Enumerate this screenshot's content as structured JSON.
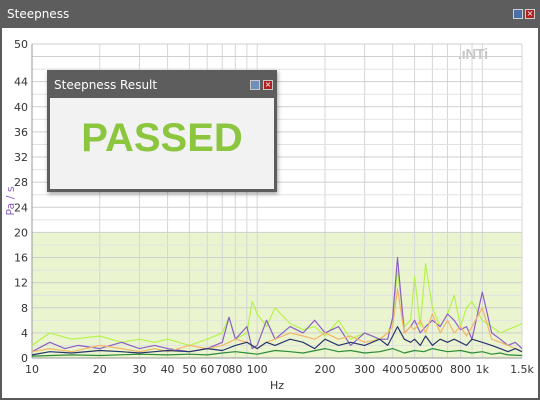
{
  "window": {
    "title": "Steepness"
  },
  "popup": {
    "title": "Steepness Result",
    "result_text": "PASSED"
  },
  "brand": {
    "logo_text": ".ıNTi"
  },
  "colors": {
    "pass": "#8cc63f",
    "limit_band": "#eaf5cf",
    "series_lime": "#b6f24d",
    "series_purple": "#8a5fc8",
    "series_orange": "#f2b56a",
    "series_navy": "#27356b",
    "series_green": "#2e8b3a"
  },
  "chart_data": {
    "type": "line",
    "title": "",
    "xlabel": "Hz",
    "ylabel": "Pa / s",
    "xscale": "log",
    "xlim": [
      10,
      1500
    ],
    "ylim": [
      0,
      50
    ],
    "x_ticks": [
      10,
      20,
      30,
      40,
      50,
      60,
      70,
      80,
      100,
      200,
      300,
      400,
      500,
      600,
      800,
      1000,
      1500
    ],
    "x_tick_labels": [
      "10",
      "20",
      "30",
      "40",
      "50",
      "60",
      "70",
      "80",
      "100",
      "200",
      "300",
      "400",
      "500",
      "600",
      "800",
      "1k",
      "1.5k"
    ],
    "y_ticks": [
      0,
      4,
      8,
      12,
      16,
      20,
      24,
      28,
      32,
      36,
      40,
      44,
      50
    ],
    "limit_band": [
      0,
      20
    ],
    "grid": true,
    "legend": "none",
    "series": [
      {
        "color": "#b6f24d",
        "x": [
          10,
          12,
          15,
          20,
          25,
          30,
          35,
          40,
          50,
          60,
          70,
          75,
          80,
          90,
          95,
          100,
          110,
          120,
          140,
          160,
          180,
          200,
          230,
          260,
          300,
          350,
          380,
          400,
          420,
          450,
          480,
          500,
          530,
          560,
          600,
          650,
          700,
          750,
          800,
          850,
          900,
          1000,
          1100,
          1200,
          1300,
          1400,
          1500
        ],
        "y": [
          2,
          4,
          3,
          3.5,
          2.5,
          3,
          2.5,
          3,
          2,
          3,
          4,
          6.5,
          3,
          4,
          9,
          7,
          5,
          8,
          5.5,
          4.5,
          5,
          3.5,
          6,
          3,
          4,
          3,
          4,
          6,
          14,
          5,
          6,
          13,
          5,
          15,
          8,
          5,
          7,
          10,
          5,
          8,
          9,
          6,
          5,
          4,
          4.5,
          5,
          5.5
        ]
      },
      {
        "color": "#8a5fc8",
        "x": [
          10,
          12,
          14,
          16,
          20,
          25,
          30,
          35,
          40,
          50,
          60,
          70,
          75,
          80,
          90,
          95,
          100,
          110,
          120,
          140,
          160,
          180,
          200,
          230,
          260,
          300,
          350,
          380,
          400,
          420,
          450,
          480,
          500,
          530,
          560,
          600,
          650,
          700,
          750,
          800,
          850,
          900,
          1000,
          1100,
          1200,
          1300,
          1400,
          1500
        ],
        "y": [
          1,
          2.5,
          1.5,
          2,
          1.5,
          2.5,
          1.5,
          2,
          1.5,
          1,
          1.5,
          2.5,
          6.5,
          3,
          5,
          1.5,
          2,
          6,
          3,
          5,
          4,
          6,
          4,
          5,
          2,
          4,
          3,
          3,
          6.5,
          16,
          4,
          5,
          6,
          4,
          5,
          6,
          5,
          7,
          6,
          4.5,
          5,
          3,
          10.5,
          4,
          3,
          2,
          2.5,
          1.5
        ]
      },
      {
        "color": "#f2b56a",
        "x": [
          10,
          12,
          15,
          20,
          25,
          30,
          35,
          40,
          50,
          60,
          70,
          80,
          90,
          100,
          110,
          120,
          140,
          160,
          180,
          200,
          230,
          260,
          300,
          350,
          380,
          400,
          420,
          450,
          480,
          500,
          530,
          560,
          600,
          650,
          700,
          750,
          800,
          850,
          900,
          1000,
          1100,
          1200,
          1300,
          1400,
          1500
        ],
        "y": [
          1,
          1.5,
          1,
          2,
          1.5,
          1,
          1.5,
          1,
          2,
          1.5,
          2,
          3,
          2.5,
          1.5,
          2.5,
          3,
          4,
          3.5,
          3,
          4,
          3,
          3.5,
          2.5,
          3,
          4,
          5,
          11,
          4,
          5,
          4.5,
          6,
          4,
          7,
          4,
          6,
          4,
          5,
          3.5,
          5,
          8,
          3,
          2.5,
          2,
          1.5,
          1
        ]
      },
      {
        "color": "#27356b",
        "x": [
          10,
          12,
          15,
          20,
          25,
          30,
          35,
          40,
          50,
          60,
          70,
          80,
          90,
          100,
          110,
          120,
          140,
          160,
          180,
          200,
          230,
          260,
          300,
          350,
          380,
          400,
          420,
          450,
          480,
          500,
          530,
          560,
          600,
          650,
          700,
          750,
          800,
          850,
          900,
          1000,
          1100,
          1200,
          1300,
          1400,
          1500
        ],
        "y": [
          0.5,
          1,
          0.8,
          1.2,
          1,
          0.8,
          1,
          1.2,
          1,
          1.5,
          1.2,
          2,
          2.5,
          1.5,
          2.5,
          2,
          3,
          2.5,
          1.5,
          3,
          2,
          2.5,
          2,
          3,
          2,
          3.5,
          5,
          3,
          2.5,
          3,
          2,
          3.5,
          2,
          3,
          2.5,
          3,
          2.5,
          2,
          3,
          2.5,
          2,
          1.5,
          1,
          1.5,
          1
        ]
      },
      {
        "color": "#2e8b3a",
        "x": [
          10,
          15,
          20,
          30,
          40,
          50,
          60,
          70,
          80,
          90,
          100,
          120,
          140,
          160,
          200,
          230,
          260,
          300,
          350,
          400,
          450,
          500,
          550,
          600,
          700,
          800,
          900,
          1000,
          1100,
          1200,
          1300,
          1500
        ],
        "y": [
          0.3,
          0.5,
          0.4,
          0.6,
          0.5,
          0.6,
          0.5,
          0.8,
          1,
          0.8,
          0.6,
          1.2,
          1,
          0.8,
          1.5,
          1,
          1.2,
          0.8,
          1,
          1.5,
          0.8,
          1.2,
          1,
          1.5,
          1,
          1.2,
          0.8,
          1,
          0.6,
          0.8,
          0.5,
          0.4
        ]
      }
    ]
  }
}
